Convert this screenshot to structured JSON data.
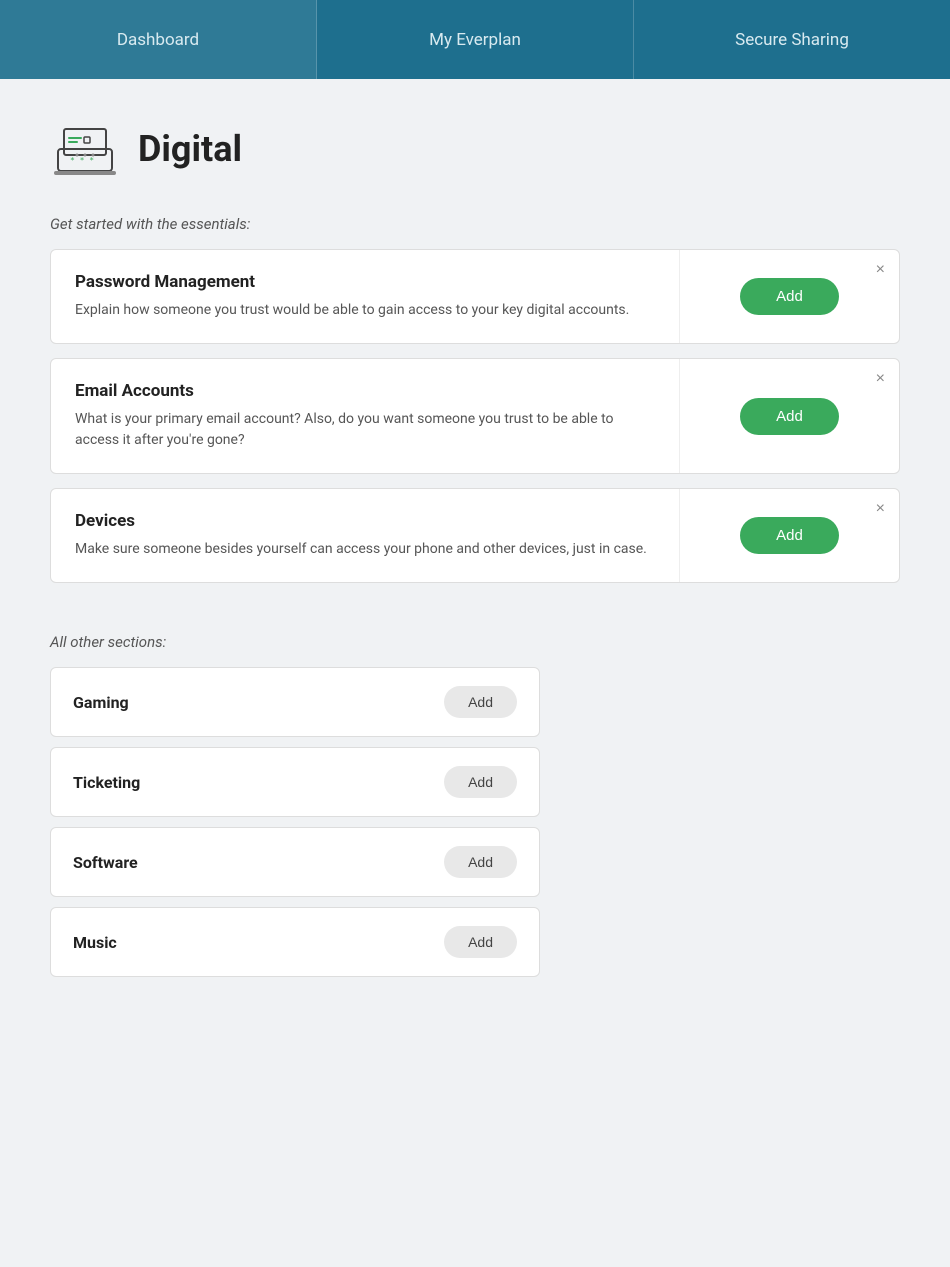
{
  "nav": {
    "items": [
      {
        "id": "dashboard",
        "label": "Dashboard"
      },
      {
        "id": "my-everplan",
        "label": "My Everplan"
      },
      {
        "id": "secure-sharing",
        "label": "Secure Sharing"
      }
    ]
  },
  "page": {
    "title": "Digital",
    "essentials_label": "Get started with the essentials:",
    "others_label": "All other sections:"
  },
  "essentials": [
    {
      "id": "password-management",
      "title": "Password Management",
      "description": "Explain how someone you trust would be able to gain access to your key digital accounts.",
      "add_label": "Add"
    },
    {
      "id": "email-accounts",
      "title": "Email Accounts",
      "description": "What is your primary email account? Also, do you want someone you trust to be able to access it after you're gone?",
      "add_label": "Add"
    },
    {
      "id": "devices",
      "title": "Devices",
      "description": "Make sure someone besides yourself can access your phone and other devices, just in case.",
      "add_label": "Add"
    }
  ],
  "others": [
    {
      "id": "gaming",
      "title": "Gaming",
      "add_label": "Add"
    },
    {
      "id": "ticketing",
      "title": "Ticketing",
      "add_label": "Add"
    },
    {
      "id": "software",
      "title": "Software",
      "add_label": "Add"
    },
    {
      "id": "music",
      "title": "Music",
      "add_label": "Add"
    }
  ],
  "icons": {
    "close": "×",
    "digital_svg": true
  }
}
